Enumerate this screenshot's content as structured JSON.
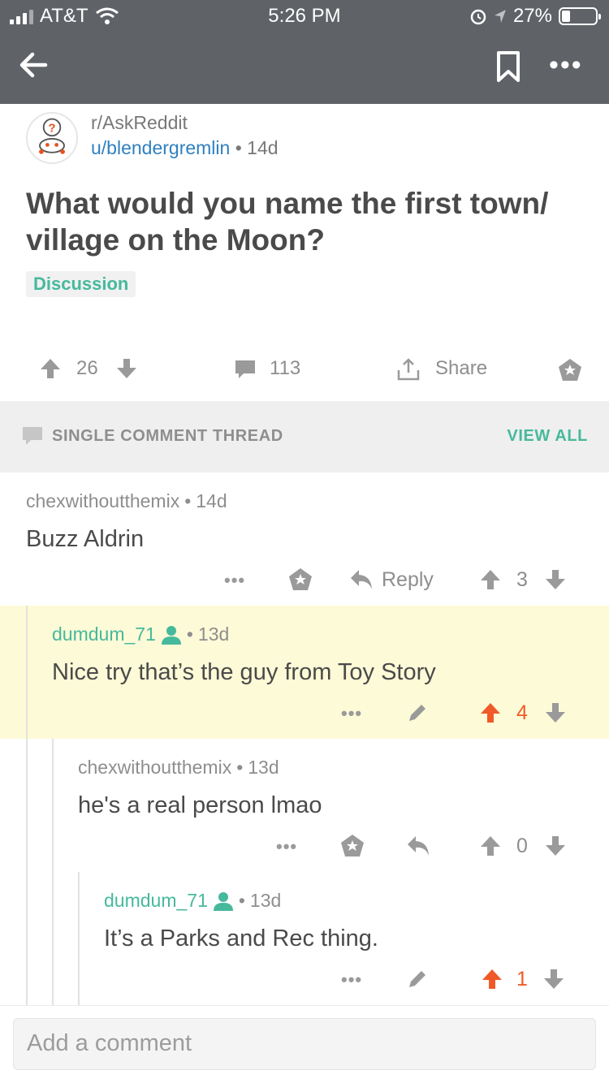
{
  "status_bar": {
    "carrier": "AT&T",
    "time": "5:26 PM",
    "battery": "27%"
  },
  "post": {
    "subreddit": "r/AskReddit",
    "author": "u/blendergremlin",
    "age": "14d",
    "title": "What would you name the first town/ village on the Moon?",
    "flair": "Discussion",
    "score": "26",
    "comments": "113",
    "share_label": "Share"
  },
  "thread_bar": {
    "label": "SINGLE COMMENT THREAD",
    "view_all": "VIEW ALL"
  },
  "comments": [
    {
      "author": "chexwithoutthemix",
      "age": "14d",
      "body": "Buzz Aldrin",
      "reply_label": "Reply",
      "score": "3"
    },
    {
      "author": "dumdum_71",
      "age": "13d",
      "body": "Nice try that’s the guy from Toy Story",
      "score": "4"
    },
    {
      "author": "chexwithoutthemix",
      "age": "13d",
      "body": "he's a real person lmao",
      "score": "0"
    },
    {
      "author": "dumdum_71",
      "age": "13d",
      "body": "It’s a Parks and Rec thing.",
      "score": "1"
    }
  ],
  "composer": {
    "placeholder": "Add a comment"
  },
  "colors": {
    "header_bg": "#5f6368",
    "accent_green": "#46b99c",
    "upvote_orange": "#f05a28",
    "highlight_bg": "#fdfad7"
  },
  "icons": [
    "back-icon",
    "bookmark-icon",
    "more-icon",
    "upvote-icon",
    "downvote-icon",
    "comment-icon",
    "share-icon",
    "award-icon",
    "reply-icon",
    "edit-icon",
    "user-icon"
  ]
}
